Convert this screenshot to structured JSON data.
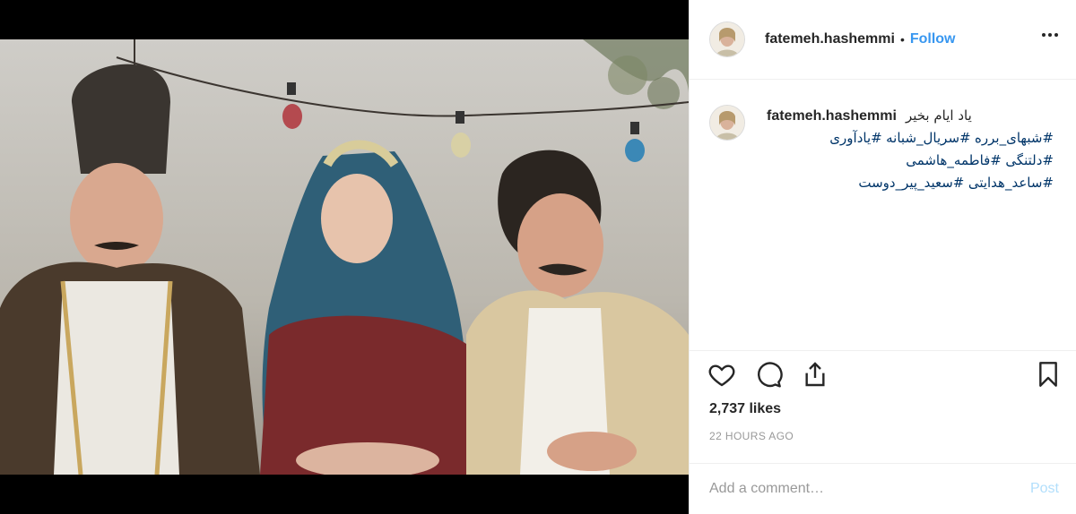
{
  "post": {
    "username": "fatemeh.hashemmi",
    "follow_label": "Follow",
    "separator": "•",
    "more_icon": "more-horizontal-icon"
  },
  "caption": {
    "username": "fatemeh.hashemmi",
    "text": "یاد ایام بخیر",
    "tag_lines": [
      [
        "#شبهای_برره",
        "#سریال_شبانه",
        "#یادآوری"
      ],
      [
        "#دلتنگی",
        "#فاطمه_هاشمی"
      ],
      [
        "#ساعد_هدایتی",
        "#سعید_پیر_دوست"
      ]
    ]
  },
  "actions": {
    "like_icon": "heart-icon",
    "comment_icon": "comment-icon",
    "share_icon": "share-icon",
    "save_icon": "bookmark-icon"
  },
  "likes": "2,737 likes",
  "timestamp": "22 HOURS AGO",
  "comment": {
    "placeholder": "Add a comment…",
    "post_label": "Post"
  },
  "colors": {
    "link_blue": "#3897f0",
    "hashtag": "#003569",
    "post_disabled": "#b2dffc",
    "muted": "#999999",
    "border": "#efefef"
  }
}
